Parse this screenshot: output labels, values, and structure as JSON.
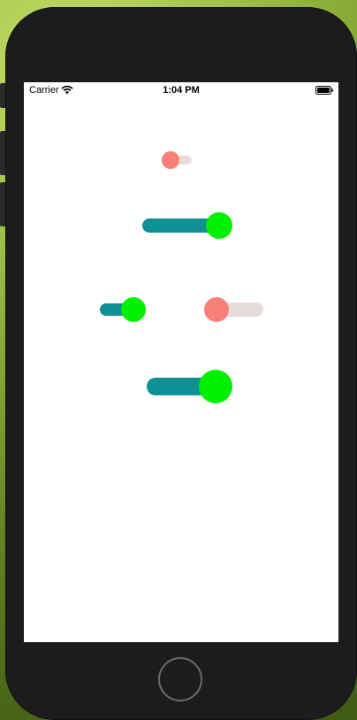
{
  "status_bar": {
    "carrier": "Carrier",
    "time": "1:04 PM",
    "icons": [
      "wifi-icon",
      "battery-icon"
    ]
  },
  "colors": {
    "on_track": "#0e9094",
    "on_thumb": "#00f000",
    "off_track": "#e6dadb",
    "off_thumb": "#f88079",
    "device_frame": "#1c1c1e",
    "screen_bg": "#ffffff"
  },
  "toggles": [
    {
      "name": "switch-tiny",
      "on": false
    },
    {
      "name": "switch-medium-wide",
      "on": true
    },
    {
      "name": "switch-small-left",
      "on": true
    },
    {
      "name": "switch-small-right",
      "on": false
    },
    {
      "name": "switch-large",
      "on": true
    }
  ]
}
